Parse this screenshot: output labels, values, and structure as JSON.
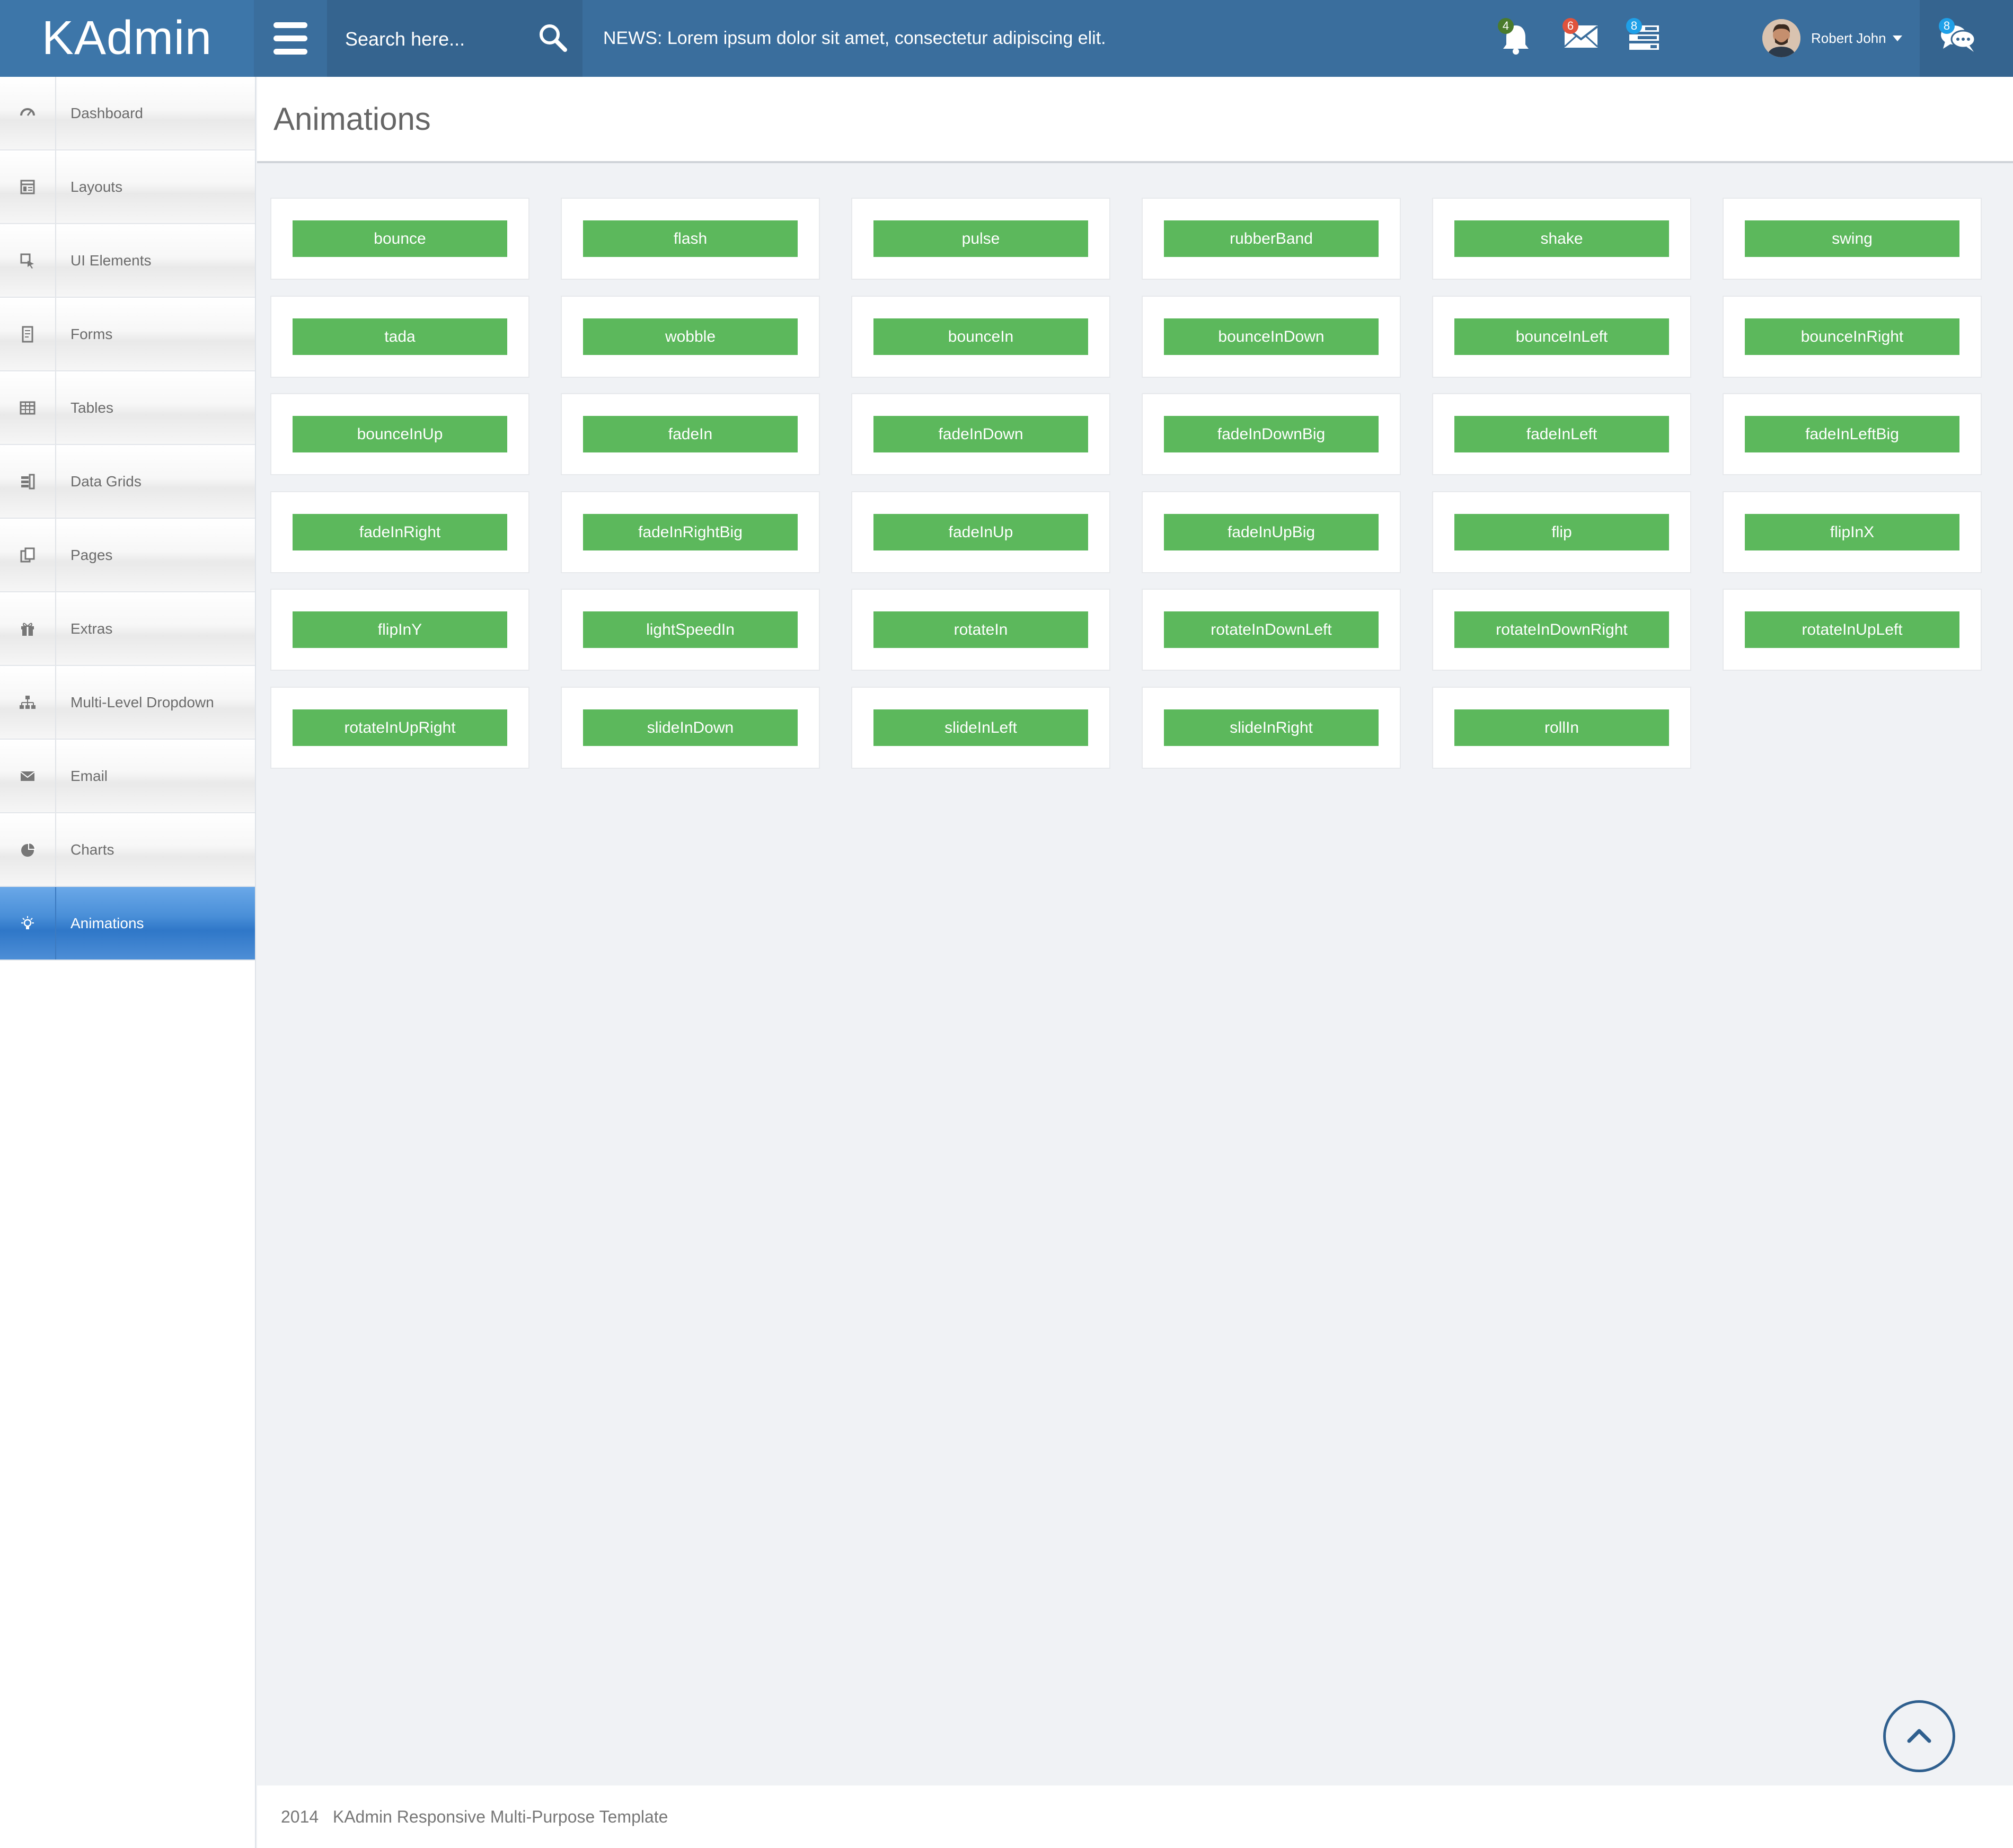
{
  "brand": "KAdmin",
  "search": {
    "placeholder": "Search here..."
  },
  "news": "NEWS: Lorem ipsum dolor sit amet, consectetur adipiscing elit.",
  "notifications": [
    {
      "name": "bell-icon",
      "count": "4",
      "color": "#4a7b2c"
    },
    {
      "name": "envelope-icon",
      "count": "6",
      "color": "#e0533d"
    },
    {
      "name": "tasks-icon",
      "count": "8",
      "color": "#1fa0e8"
    }
  ],
  "user": {
    "name": "Robert John"
  },
  "chat": {
    "count": "8",
    "color": "#1fa0e8"
  },
  "sidebar": {
    "items": [
      {
        "label": "Dashboard",
        "icon": "dashboard-icon"
      },
      {
        "label": "Layouts",
        "icon": "layouts-icon"
      },
      {
        "label": "UI Elements",
        "icon": "ui-elements-icon"
      },
      {
        "label": "Forms",
        "icon": "forms-icon"
      },
      {
        "label": "Tables",
        "icon": "tables-icon"
      },
      {
        "label": "Data Grids",
        "icon": "data-grids-icon"
      },
      {
        "label": "Pages",
        "icon": "pages-icon"
      },
      {
        "label": "Extras",
        "icon": "gift-icon"
      },
      {
        "label": "Multi-Level Dropdown",
        "icon": "sitemap-icon"
      },
      {
        "label": "Email",
        "icon": "email-icon"
      },
      {
        "label": "Charts",
        "icon": "pie-chart-icon"
      },
      {
        "label": "Animations",
        "icon": "bulb-icon",
        "active": true
      }
    ]
  },
  "page": {
    "title": "Animations"
  },
  "animations": [
    "bounce",
    "flash",
    "pulse",
    "rubberBand",
    "shake",
    "swing",
    "tada",
    "wobble",
    "bounceIn",
    "bounceInDown",
    "bounceInLeft",
    "bounceInRight",
    "bounceInUp",
    "fadeIn",
    "fadeInDown",
    "fadeInDownBig",
    "fadeInLeft",
    "fadeInLeftBig",
    "fadeInRight",
    "fadeInRightBig",
    "fadeInUp",
    "fadeInUpBig",
    "flip",
    "flipInX",
    "flipInY",
    "lightSpeedIn",
    "rotateIn",
    "rotateInDownLeft",
    "rotateInDownRight",
    "rotateInUpLeft",
    "rotateInUpRight",
    "slideInDown",
    "slideInLeft",
    "slideInRight",
    "rollIn"
  ],
  "footer": {
    "year": "2014",
    "text": "KAdmin Responsive Multi-Purpose Template"
  }
}
